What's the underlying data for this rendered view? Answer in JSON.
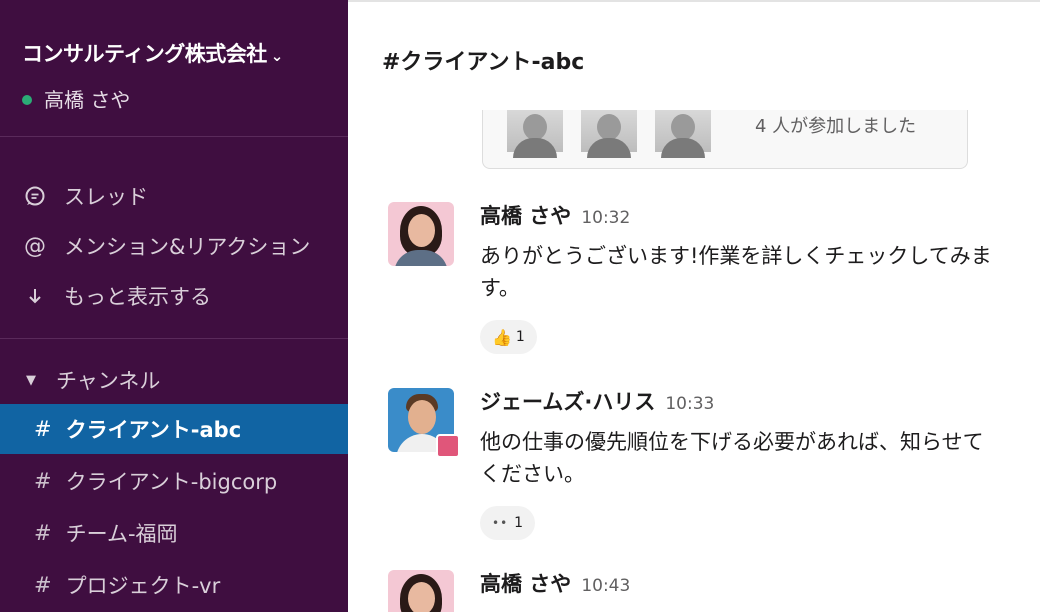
{
  "sidebar": {
    "workspace_name": "コンサルティング株式会社",
    "workspace_chevron": "⌄",
    "user_name": "高橋 さや",
    "nav": [
      {
        "icon": "thread-icon",
        "label": "スレッド"
      },
      {
        "icon": "at-icon",
        "label": "メンション&リアクション"
      },
      {
        "icon": "arrow-down-icon",
        "label": "もっと表示する"
      }
    ],
    "section_label": "チャンネル",
    "channels": [
      {
        "name": "クライアント-abc",
        "active": true
      },
      {
        "name": "クライアント-bigcorp",
        "active": false
      },
      {
        "name": "チーム-福岡",
        "active": false
      },
      {
        "name": "プロジェクト-vr",
        "active": false
      }
    ]
  },
  "main": {
    "channel_title": "#クライアント-abc",
    "join_text": "4 人が参加しました",
    "messages": [
      {
        "author": "高橋 さや",
        "time": "10:32",
        "text": "ありがとうございます!作業を詳しくチェックしてみます。",
        "reaction": {
          "emoji": "👍",
          "count": "1"
        }
      },
      {
        "author": "ジェームズ·ハリス",
        "time": "10:33",
        "text": "他の仕事の優先順位を下げる必要があれば、知らせてください。",
        "reaction": {
          "emoji": "••",
          "count": "1"
        }
      },
      {
        "author": "高橋 さや",
        "time": "10:43"
      }
    ]
  },
  "colors": {
    "sidebar_bg": "#3f0e40",
    "active_channel_bg": "#1164a3",
    "presence_online": "#2bac76",
    "status_badge": "#e0567a"
  }
}
